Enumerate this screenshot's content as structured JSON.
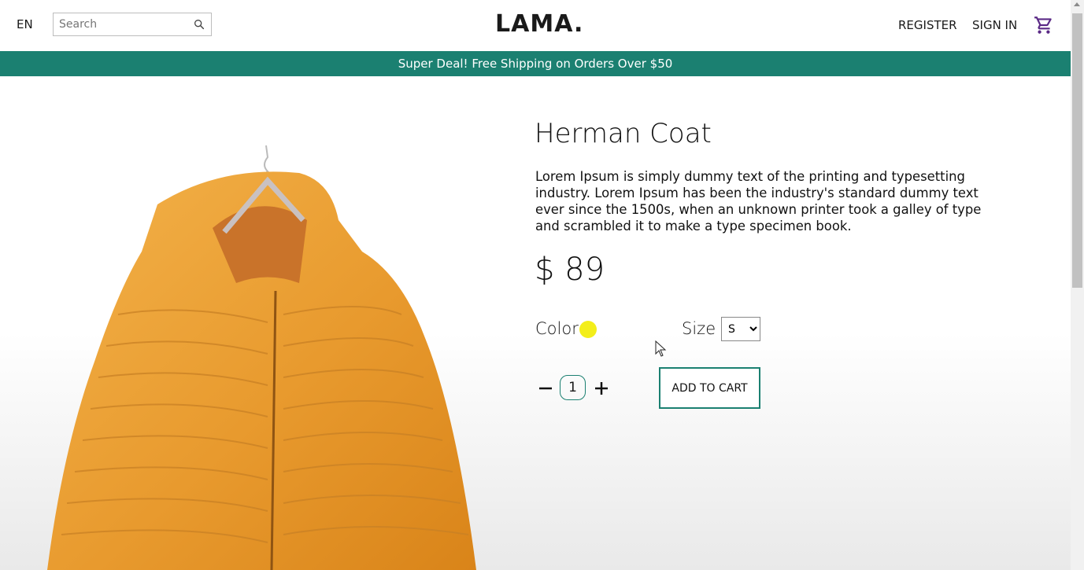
{
  "navbar": {
    "lang": "EN",
    "search_placeholder": "Search",
    "logo": "LAMA.",
    "register": "REGISTER",
    "sign_in": "SIGN IN"
  },
  "announcement": "Super Deal! Free Shipping on Orders Over $50",
  "product": {
    "title": "Herman Coat",
    "description": "Lorem Ipsum is simply dummy text of the printing and typesetting industry. Lorem Ipsum has been the industry's standard dummy text ever since the 1500s, when an unknown printer took a galley of type and scrambled it to make a type specimen book.",
    "price": "$ 89",
    "color_label": "Color",
    "color_value": "#f3ee1a",
    "size_label": "Size",
    "size_selected": "S",
    "quantity": "1",
    "add_to_cart": "ADD TO CART"
  },
  "icons": [
    "search-icon",
    "cart-icon",
    "minus-icon",
    "plus-icon"
  ],
  "colors": {
    "accent": "#1b8071",
    "swatch": "#f3ee1a"
  }
}
